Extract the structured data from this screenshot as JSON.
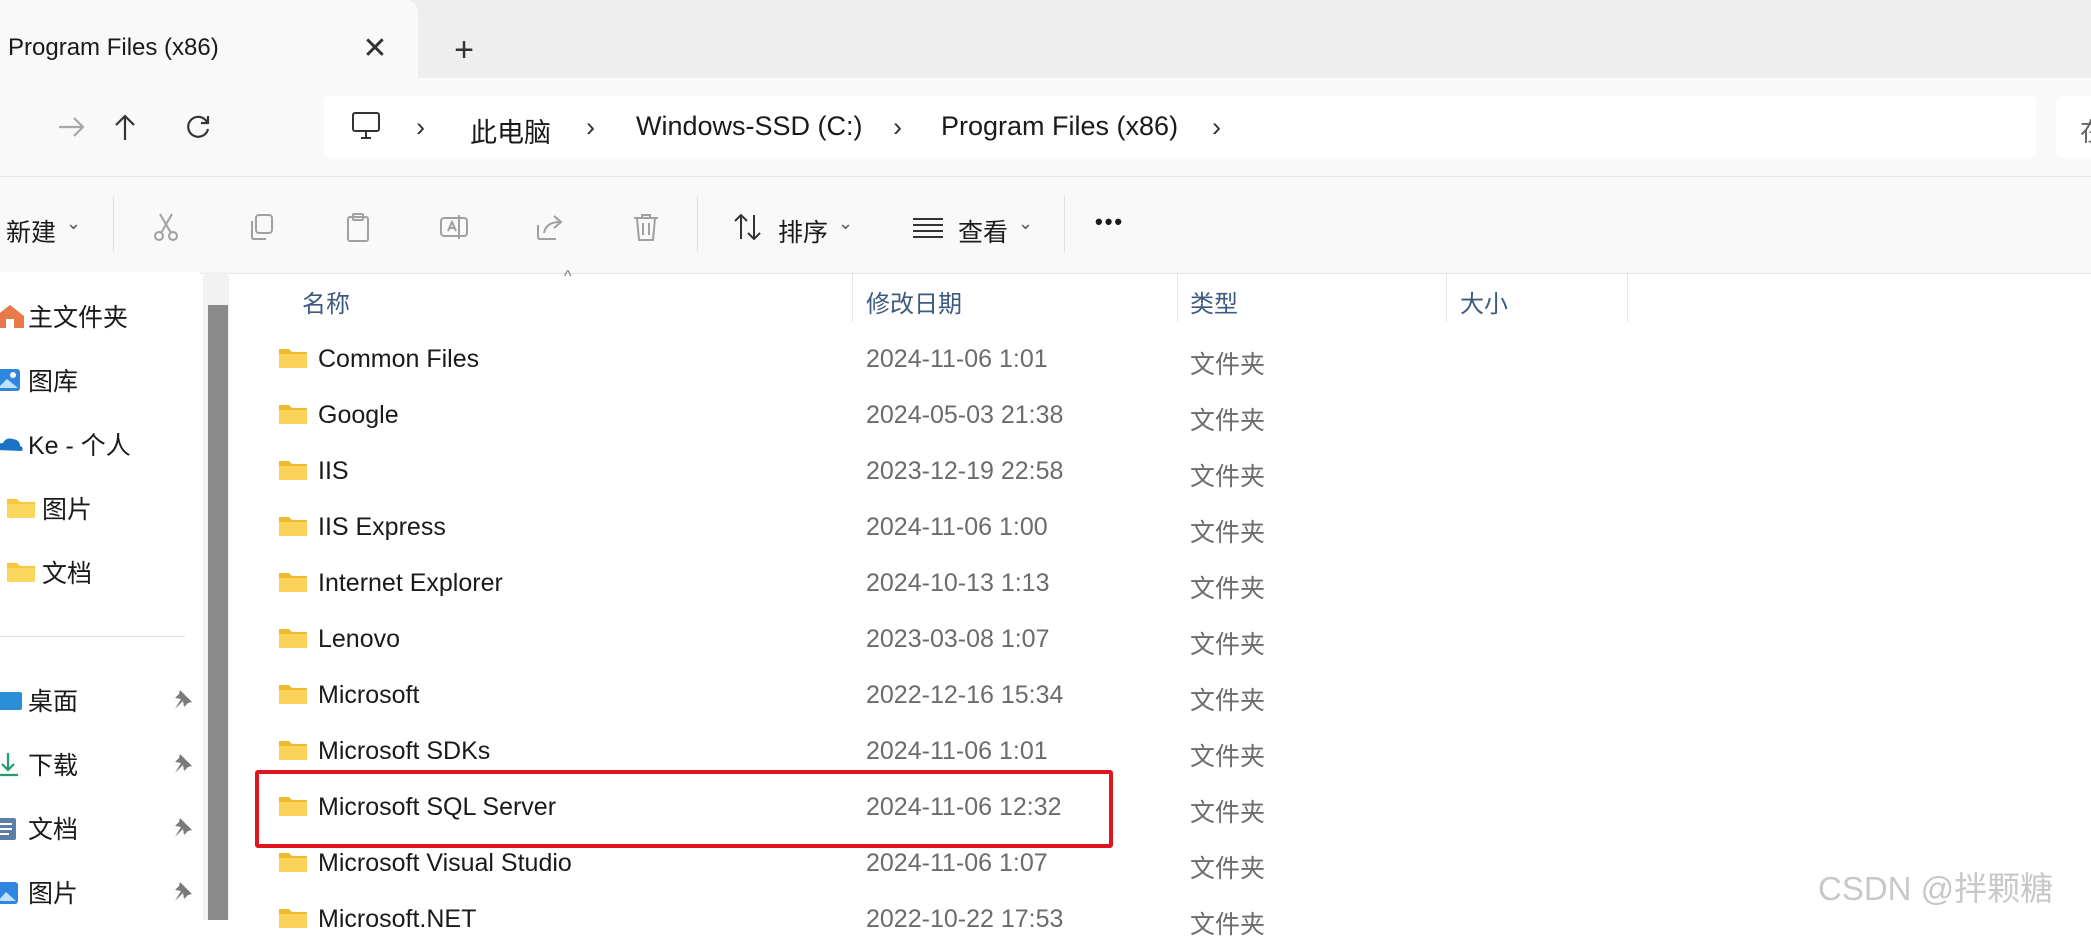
{
  "tab": {
    "title": "Program Files (x86)",
    "close": "✕",
    "new": "+"
  },
  "nav": {
    "breadcrumbs": [
      "此电脑",
      "Windows-SSD (C:)",
      "Program Files (x86)"
    ],
    "search_placeholder": "在"
  },
  "toolbar": {
    "new_label": "新建",
    "sort_label": "排序",
    "view_label": "查看",
    "more_label": "•••"
  },
  "sidebar": {
    "quick": [
      {
        "label": "主文件夹",
        "icon": "home-icon"
      },
      {
        "label": "图库",
        "icon": "gallery-icon"
      },
      {
        "label": "Ke - 个人",
        "icon": "cloud-icon"
      },
      {
        "label": "图片",
        "icon": "folder-icon"
      },
      {
        "label": "文档",
        "icon": "folder-icon"
      }
    ],
    "pinned": [
      {
        "label": "桌面",
        "icon": "desktop-icon"
      },
      {
        "label": "下载",
        "icon": "download-icon"
      },
      {
        "label": "文档",
        "icon": "document-icon"
      },
      {
        "label": "图片",
        "icon": "picture-icon"
      }
    ]
  },
  "columns": {
    "name": "名称",
    "modified": "修改日期",
    "type": "类型",
    "size": "大小"
  },
  "files": [
    {
      "name": "Common Files",
      "modified": "2024-11-06 1:01",
      "type": "文件夹"
    },
    {
      "name": "Google",
      "modified": "2024-05-03 21:38",
      "type": "文件夹"
    },
    {
      "name": "IIS",
      "modified": "2023-12-19 22:58",
      "type": "文件夹"
    },
    {
      "name": "IIS Express",
      "modified": "2024-11-06 1:00",
      "type": "文件夹"
    },
    {
      "name": "Internet Explorer",
      "modified": "2024-10-13 1:13",
      "type": "文件夹"
    },
    {
      "name": "Lenovo",
      "modified": "2023-03-08 1:07",
      "type": "文件夹"
    },
    {
      "name": "Microsoft",
      "modified": "2022-12-16 15:34",
      "type": "文件夹"
    },
    {
      "name": "Microsoft SDKs",
      "modified": "2024-11-06 1:01",
      "type": "文件夹"
    },
    {
      "name": "Microsoft SQL Server",
      "modified": "2024-11-06 12:32",
      "type": "文件夹"
    },
    {
      "name": "Microsoft Visual Studio",
      "modified": "2024-11-06 1:07",
      "type": "文件夹"
    },
    {
      "name": "Microsoft.NET",
      "modified": "2022-10-22 17:53",
      "type": "文件夹"
    }
  ],
  "highlighted_file": "Microsoft SQL Server",
  "watermark": "CSDN @拌颗糖",
  "colors": {
    "folder": "#f5c842",
    "highlight": "#e0141e",
    "header_text": "#3d5a80"
  }
}
